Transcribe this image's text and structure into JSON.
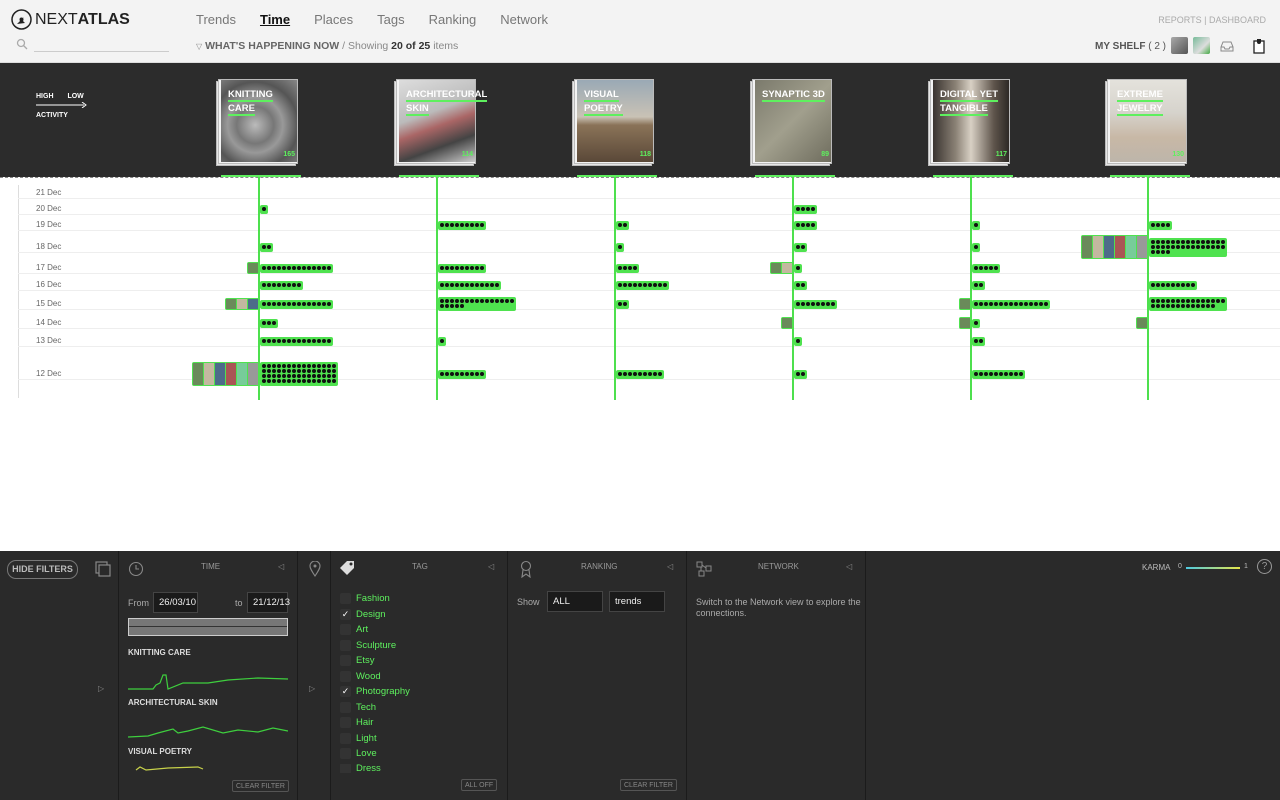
{
  "app": {
    "logo_a": "NEXT",
    "logo_b": "ATLAS"
  },
  "nav": [
    {
      "label": "Trends"
    },
    {
      "label": "Time",
      "active": true
    },
    {
      "label": "Places"
    },
    {
      "label": "Tags"
    },
    {
      "label": "Ranking"
    },
    {
      "label": "Network"
    }
  ],
  "subheader": {
    "prefix": "WHAT'S HAPPENING NOW",
    "showing": " / Showing ",
    "count": "20 of 25",
    "suffix": " items"
  },
  "toplinks": {
    "reports": "REPORTS",
    "sep": " | ",
    "dashboard": "DASHBOARD"
  },
  "shelf": {
    "label": "MY SHELF",
    "count": "( 2 )"
  },
  "legend": {
    "high": "HIGH",
    "low": "LOW",
    "activity": "ACTIVITY"
  },
  "trends": [
    {
      "title": "KNITTING CARE",
      "count": "165",
      "img": "knit"
    },
    {
      "title": "ARCHITECTURAL SKIN",
      "count": "114",
      "img": "arch"
    },
    {
      "title": "VISUAL POETRY",
      "count": "118",
      "img": "poetry"
    },
    {
      "title": "SYNAPTIC 3D",
      "count": "89",
      "img": "synaptic"
    },
    {
      "title": "DIGITAL YET TANGIBLE",
      "count": "117",
      "img": "digital"
    },
    {
      "title": "EXTREME JEWELRY",
      "count": "130",
      "img": "jewelry"
    }
  ],
  "dates": [
    "21 Dec",
    "20 Dec",
    "19 Dec",
    "18 Dec",
    "17 Dec",
    "16 Dec",
    "15 Dec",
    "14 Dec",
    "13 Dec",
    "12 Dec"
  ],
  "timeline": [
    {
      "col": 0,
      "row": "20 Dec",
      "dots": 1
    },
    {
      "col": 0,
      "row": "18 Dec",
      "dots": 2
    },
    {
      "col": 0,
      "row": "17 Dec",
      "dots": 14,
      "thumbs": 1
    },
    {
      "col": 0,
      "row": "16 Dec",
      "dots": 8
    },
    {
      "col": 0,
      "row": "15 Dec",
      "dots": 14,
      "thumbs": 3
    },
    {
      "col": 0,
      "row": "14 Dec",
      "dots": 3
    },
    {
      "col": 0,
      "row": "13 Dec",
      "dots": 14
    },
    {
      "col": 0,
      "row": "12 Dec",
      "dots": 60,
      "thumbs": 6
    },
    {
      "col": 1,
      "row": "19 Dec",
      "dots": 9
    },
    {
      "col": 1,
      "row": "17 Dec",
      "dots": 9
    },
    {
      "col": 1,
      "row": "16 Dec",
      "dots": 12
    },
    {
      "col": 1,
      "row": "15 Dec",
      "dots": 20
    },
    {
      "col": 1,
      "row": "13 Dec",
      "dots": 1
    },
    {
      "col": 1,
      "row": "12 Dec",
      "dots": 9
    },
    {
      "col": 2,
      "row": "19 Dec",
      "dots": 2
    },
    {
      "col": 2,
      "row": "18 Dec",
      "dots": 1
    },
    {
      "col": 2,
      "row": "17 Dec",
      "dots": 4
    },
    {
      "col": 2,
      "row": "16 Dec",
      "dots": 10
    },
    {
      "col": 2,
      "row": "15 Dec",
      "dots": 2
    },
    {
      "col": 2,
      "row": "12 Dec",
      "dots": 9
    },
    {
      "col": 3,
      "row": "20 Dec",
      "dots": 4
    },
    {
      "col": 3,
      "row": "19 Dec",
      "dots": 4
    },
    {
      "col": 3,
      "row": "18 Dec",
      "dots": 2
    },
    {
      "col": 3,
      "row": "17 Dec",
      "dots": 1,
      "thumbs": 2
    },
    {
      "col": 3,
      "row": "16 Dec",
      "dots": 2
    },
    {
      "col": 3,
      "row": "15 Dec",
      "dots": 8
    },
    {
      "col": 3,
      "row": "14 Dec",
      "dots": 0,
      "thumbs": 1
    },
    {
      "col": 3,
      "row": "13 Dec",
      "dots": 1
    },
    {
      "col": 3,
      "row": "12 Dec",
      "dots": 2
    },
    {
      "col": 4,
      "row": "19 Dec",
      "dots": 1
    },
    {
      "col": 4,
      "row": "18 Dec",
      "dots": 1
    },
    {
      "col": 4,
      "row": "17 Dec",
      "dots": 5
    },
    {
      "col": 4,
      "row": "16 Dec",
      "dots": 2
    },
    {
      "col": 4,
      "row": "15 Dec",
      "dots": 15,
      "thumbs": 1
    },
    {
      "col": 4,
      "row": "14 Dec",
      "dots": 1,
      "thumbs": 1
    },
    {
      "col": 4,
      "row": "13 Dec",
      "dots": 2
    },
    {
      "col": 4,
      "row": "12 Dec",
      "dots": 10
    },
    {
      "col": 5,
      "row": "19 Dec",
      "dots": 4
    },
    {
      "col": 5,
      "row": "18 Dec",
      "dots": 34,
      "thumbs": 6
    },
    {
      "col": 5,
      "row": "16 Dec",
      "dots": 9
    },
    {
      "col": 5,
      "row": "15 Dec",
      "dots": 28
    },
    {
      "col": 5,
      "row": "14 Dec",
      "dots": 0,
      "thumbs": 1
    }
  ],
  "filters": {
    "hide_button": "HIDE FILTERS",
    "time": {
      "title": "TIME",
      "from_label": "From",
      "from": "26/03/10",
      "to_label": "to",
      "to": "21/12/13",
      "clear": "CLEAR FILTER",
      "sparks": [
        "KNITTING CARE",
        "ARCHITECTURAL SKIN",
        "VISUAL POETRY"
      ]
    },
    "tag": {
      "title": "TAG",
      "all_off": "ALL OFF",
      "items": [
        {
          "label": "Fashion",
          "checked": false
        },
        {
          "label": "Design",
          "checked": true
        },
        {
          "label": "Art",
          "checked": false
        },
        {
          "label": "Sculpture",
          "checked": false
        },
        {
          "label": "Etsy",
          "checked": false
        },
        {
          "label": "Wood",
          "checked": false
        },
        {
          "label": "Photography",
          "checked": true
        },
        {
          "label": "Tech",
          "checked": false
        },
        {
          "label": "Hair",
          "checked": false
        },
        {
          "label": "Light",
          "checked": false
        },
        {
          "label": "Love",
          "checked": false
        },
        {
          "label": "Dress",
          "checked": false
        }
      ]
    },
    "ranking": {
      "title": "RANKING",
      "show_label": "Show",
      "show_value": "ALL",
      "type_value": "trends",
      "clear": "CLEAR FILTER"
    },
    "network": {
      "title": "NETWORK",
      "desc": "Switch to the Network view to explore the connections."
    },
    "karma": {
      "label": "KARMA",
      "min": "0",
      "max": "1"
    }
  }
}
